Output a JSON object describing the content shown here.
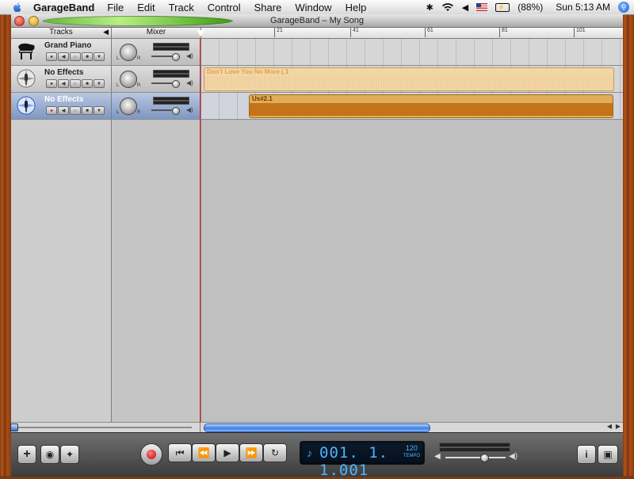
{
  "menubar": {
    "app_name": "GarageBand",
    "menus": [
      "File",
      "Edit",
      "Track",
      "Control",
      "Share",
      "Window",
      "Help"
    ],
    "battery": "(88%)",
    "clock": "Sun 5:13 AM"
  },
  "window": {
    "title": "GarageBand – My Song"
  },
  "header": {
    "tracks_label": "Tracks",
    "mixer_label": "Mixer",
    "ruler_ticks": [
      "21",
      "41",
      "61",
      "81",
      "101"
    ]
  },
  "tracks": [
    {
      "name": "Grand Piano",
      "icon": "grand-piano-icon",
      "selected": false
    },
    {
      "name": "No Effects",
      "icon": "microphone-icon",
      "selected": false
    },
    {
      "name": "No Effects",
      "icon": "microphone-icon",
      "selected": true
    }
  ],
  "regions": [
    {
      "name": "Don't Love You No More (.1",
      "color": "#f2d7a6"
    },
    {
      "name": "Us#2.1",
      "color": "#e1ad58"
    }
  ],
  "transport": {
    "position": "001. 1. 1.001",
    "tempo": "120",
    "tempo_label": "TEMPO"
  },
  "colors": {
    "playhead": "#e32020",
    "selected_track": "#7f97c2",
    "lcd_text": "#4fb3ff"
  }
}
